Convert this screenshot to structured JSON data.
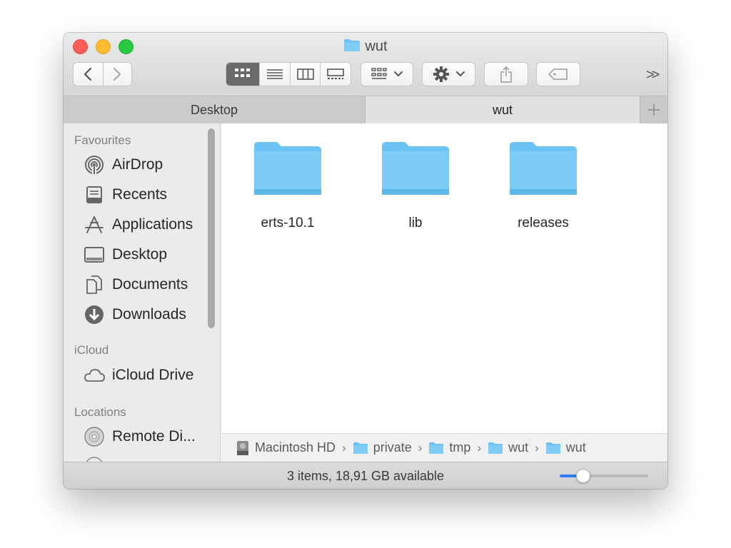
{
  "window": {
    "title": "wut",
    "folder_icon": "folder-icon"
  },
  "toolbar": {
    "back": "chevron-left-icon",
    "forward": "chevron-right-icon",
    "views": [
      "icon-view-icon",
      "list-view-icon",
      "column-view-icon",
      "gallery-view-icon"
    ],
    "active_view": "icon-view-icon",
    "group": "group-by-icon",
    "action": "gear-icon",
    "share": "share-icon",
    "tag": "tag-icon",
    "overflow": ">>"
  },
  "tabs": [
    {
      "label": "Desktop",
      "active": false
    },
    {
      "label": "wut",
      "active": true
    }
  ],
  "sidebar": {
    "sections": [
      {
        "heading": "Favourites",
        "items": [
          {
            "label": "AirDrop",
            "icon": "airdrop-icon"
          },
          {
            "label": "Recents",
            "icon": "recents-icon"
          },
          {
            "label": "Applications",
            "icon": "applications-icon"
          },
          {
            "label": "Desktop",
            "icon": "desktop-icon"
          },
          {
            "label": "Documents",
            "icon": "documents-icon"
          },
          {
            "label": "Downloads",
            "icon": "downloads-icon"
          }
        ]
      },
      {
        "heading": "iCloud",
        "items": [
          {
            "label": "iCloud Drive",
            "icon": "cloud-icon"
          }
        ]
      },
      {
        "heading": "Locations",
        "items": [
          {
            "label": "Remote Di...",
            "icon": "disc-icon"
          }
        ]
      }
    ]
  },
  "folders": [
    {
      "name": "erts-10.1",
      "icon": "folder-icon"
    },
    {
      "name": "lib",
      "icon": "folder-icon"
    },
    {
      "name": "releases",
      "icon": "folder-icon"
    }
  ],
  "pathbar": [
    {
      "label": "Macintosh HD",
      "icon": "hard-drive-icon"
    },
    {
      "label": "private",
      "icon": "folder-icon"
    },
    {
      "label": "tmp",
      "icon": "folder-icon"
    },
    {
      "label": "wut",
      "icon": "folder-icon"
    },
    {
      "label": "wut",
      "icon": "folder-icon"
    }
  ],
  "status": {
    "text": "3 items, 18,91 GB available",
    "icon_size_fraction": 0.26
  },
  "colors": {
    "folder": "#6ac3f4",
    "accent": "#2f7cf6",
    "close": "#fc5f57",
    "minimize": "#fdbd2e",
    "zoom": "#28c840"
  }
}
